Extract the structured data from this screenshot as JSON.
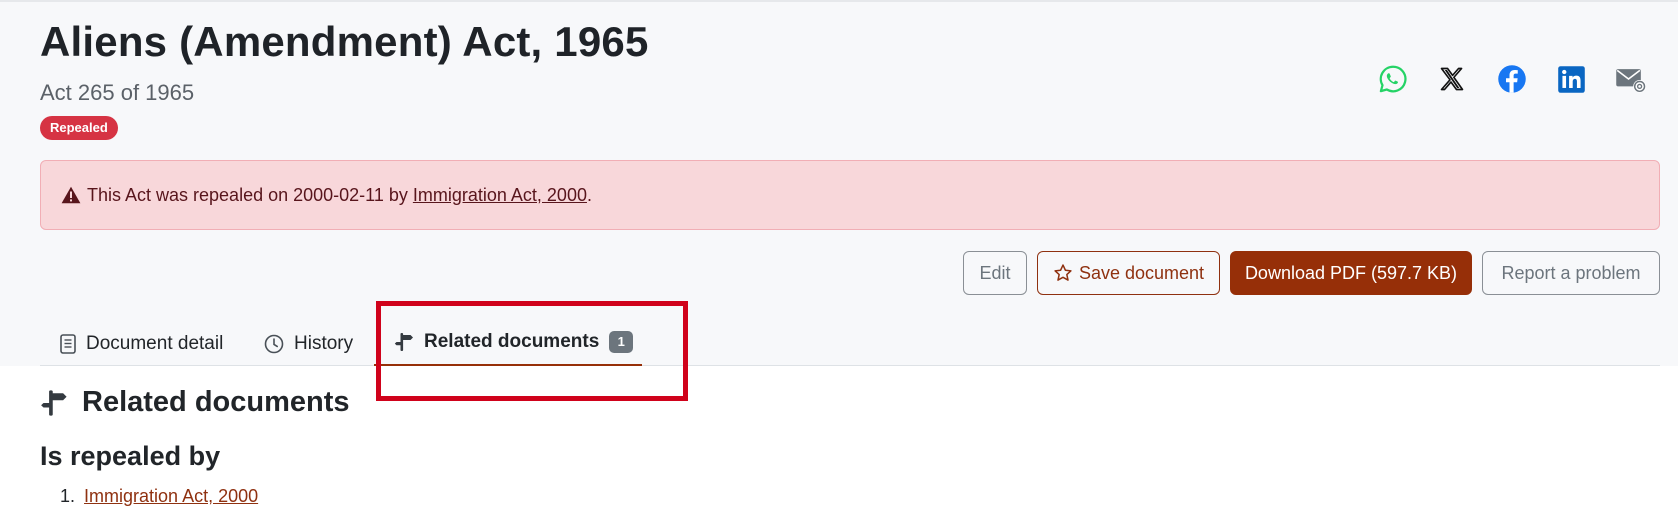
{
  "document": {
    "title": "Aliens (Amendment) Act, 1965",
    "subtitle": "Act 265 of 1965",
    "status_badge": "Repealed"
  },
  "share": {
    "icons": [
      "whatsapp-icon",
      "x-icon",
      "facebook-icon",
      "linkedin-icon",
      "email-icon"
    ]
  },
  "alert": {
    "text": "This Act was repealed on 2000-02-11 by",
    "link": "Immigration Act, 2000",
    "suffix": "."
  },
  "actions": {
    "edit": "Edit",
    "save": "Save document",
    "download": "Download PDF (597.7 KB)",
    "report": "Report a problem"
  },
  "tabs": [
    {
      "label": "Document detail"
    },
    {
      "label": "History"
    },
    {
      "label": "Related documents",
      "count": "1",
      "active": true
    }
  ],
  "related": {
    "heading": "Related documents",
    "subheading": "Is repealed by",
    "items": [
      {
        "number": "1.",
        "label": "Immigration Act, 2000"
      }
    ]
  },
  "colors": {
    "accent": "#962f08",
    "danger": "#d63343",
    "alert_bg": "#f8d7da",
    "highlight": "#d0021b"
  }
}
